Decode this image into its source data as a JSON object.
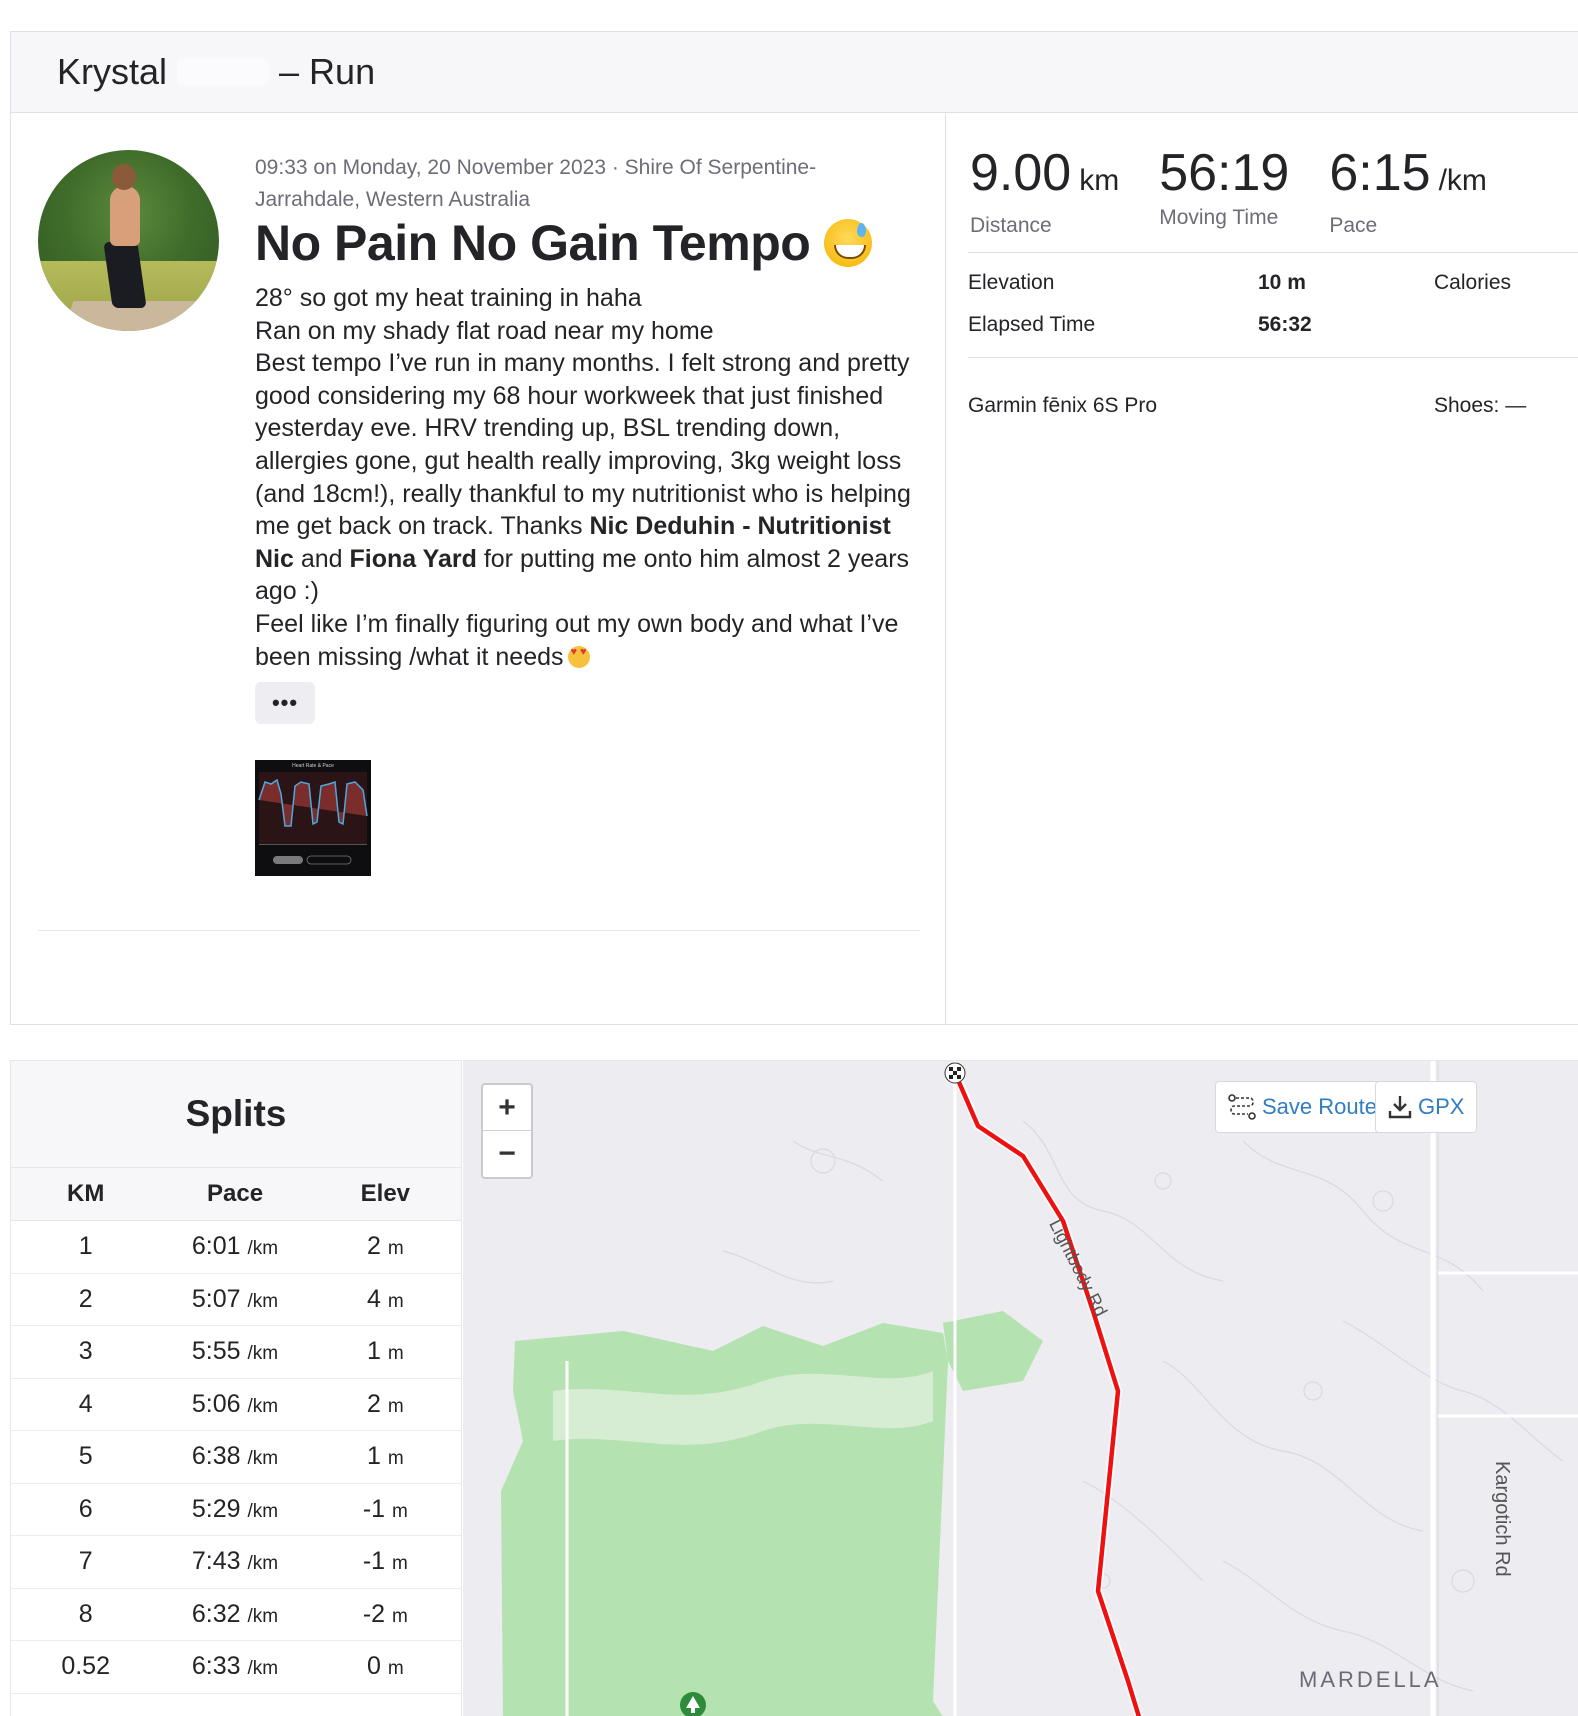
{
  "header": {
    "name_first": "Krystal",
    "suffix": "– Run"
  },
  "activity": {
    "meta_line": "09:33 on Monday, 20 November 2023 · Shire Of Serpentine-Jarrahdale, Western Australia",
    "title": "No Pain No Gain Tempo",
    "description": {
      "line1": "28° so got my heat training in haha",
      "line2": "Ran on my shady flat road near my home",
      "para_a": "Best tempo I’ve run in many months. I felt strong and pretty good considering my 68 hour workweek that just finished yesterday eve. HRV trending up, BSL trending down, allergies gone, gut health really improving, 3kg weight loss (and 18cm!), really thankful to my nutritionist who is helping me get back on track. Thanks ",
      "mention1": "Nic Deduhin - Nutritionist Nic",
      "and": " and ",
      "mention2": "Fiona Yard",
      "para_b": " for putting me onto him almost 2 years ago :)",
      "line_last": "Feel like I’m finally figuring out my own body and what I’ve been missing /what it needs"
    },
    "more_label": "•••",
    "photo_caption": "Heart Rate & Pace"
  },
  "stats": {
    "distance": {
      "value": "9.00",
      "unit": "km",
      "label": "Distance"
    },
    "moving_time": {
      "value": "56:19",
      "label": "Moving Time"
    },
    "pace": {
      "value": "6:15",
      "unit": "/km",
      "label": "Pace"
    },
    "elevation": {
      "label": "Elevation",
      "value": "10 m"
    },
    "elapsed": {
      "label": "Elapsed Time",
      "value": "56:32"
    },
    "calories": {
      "label": "Calories"
    },
    "device": "Garmin fēnix 6S Pro",
    "shoes": "Shoes: —"
  },
  "splits": {
    "title": "Splits",
    "headers": {
      "km": "KM",
      "pace": "Pace",
      "elev": "Elev"
    },
    "pace_unit": "/km",
    "elev_unit": "m",
    "rows": [
      {
        "km": "1",
        "pace": "6:01",
        "elev": "2"
      },
      {
        "km": "2",
        "pace": "5:07",
        "elev": "4"
      },
      {
        "km": "3",
        "pace": "5:55",
        "elev": "1"
      },
      {
        "km": "4",
        "pace": "5:06",
        "elev": "2"
      },
      {
        "km": "5",
        "pace": "6:38",
        "elev": "1"
      },
      {
        "km": "6",
        "pace": "5:29",
        "elev": "-1"
      },
      {
        "km": "7",
        "pace": "7:43",
        "elev": "-1"
      },
      {
        "km": "8",
        "pace": "6:32",
        "elev": "-2"
      },
      {
        "km": "0.52",
        "pace": "6:33",
        "elev": "0"
      }
    ]
  },
  "map": {
    "zoom_in": "+",
    "zoom_out": "−",
    "save_route": "Save Route",
    "gpx": "GPX",
    "road1": "Lightbody Rd",
    "road2": "Kargotich Rd",
    "suburb": "MARDELLA",
    "route_color": "#ee1111",
    "park_color": "#b4e2b0"
  }
}
